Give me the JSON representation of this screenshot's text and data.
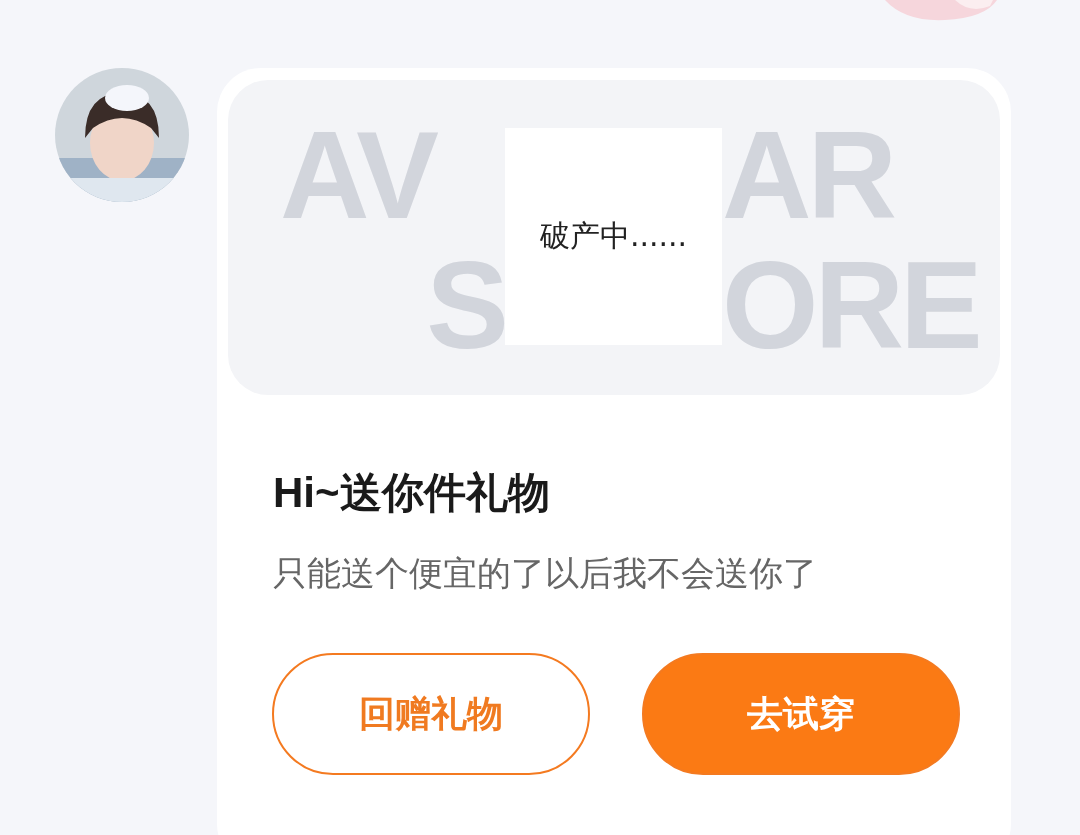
{
  "message": {
    "card": {
      "banner": {
        "left_lines": [
          "AV",
          "S"
        ],
        "right_lines": [
          "AR",
          "ORE"
        ],
        "sticker": {
          "text": "破产中......"
        }
      },
      "title": "Hi~送你件礼物",
      "subtitle": "只能送个便宜的了以后我不会送你了",
      "buttons": [
        {
          "label": "回赠礼物",
          "kind": "outline"
        },
        {
          "label": "去试穿",
          "kind": "filled"
        }
      ]
    }
  }
}
